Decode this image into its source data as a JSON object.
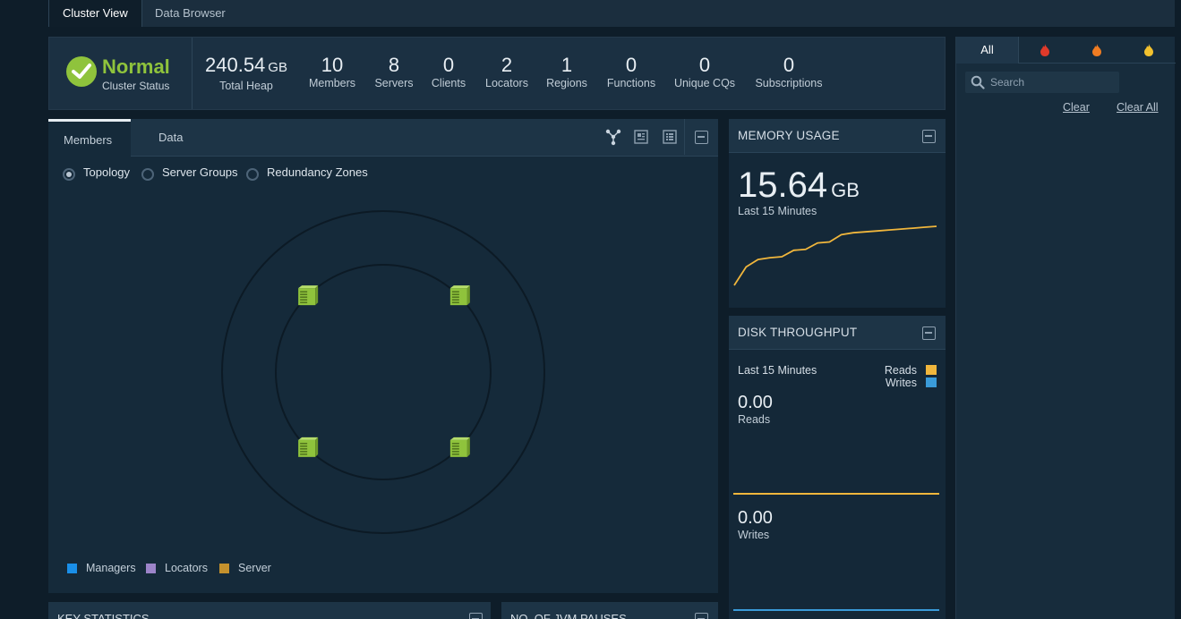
{
  "tabs": {
    "cluster_view": "Cluster View",
    "data_browser": "Data Browser"
  },
  "status": {
    "state": "Normal",
    "label": "Cluster Status",
    "color": "#8fc33c"
  },
  "stats": {
    "heap": {
      "value": "240.54",
      "unit": "GB",
      "label": "Total Heap"
    },
    "members": {
      "value": "10",
      "label": "Members"
    },
    "servers": {
      "value": "8",
      "label": "Servers"
    },
    "clients": {
      "value": "0",
      "label": "Clients"
    },
    "locators": {
      "value": "2",
      "label": "Locators"
    },
    "regions": {
      "value": "1",
      "label": "Regions"
    },
    "functions": {
      "value": "0",
      "label": "Functions"
    },
    "unique_cqs": {
      "value": "0",
      "label": "Unique CQs"
    },
    "subscriptions": {
      "value": "0",
      "label": "Subscriptions"
    }
  },
  "members_panel": {
    "tabs": {
      "members": "Members",
      "data": "Data"
    },
    "toolbar_icons": [
      "topology-view-icon",
      "detail-view-icon",
      "grid-view-icon",
      "minimize-icon"
    ],
    "view_options": {
      "topology": "Topology",
      "server_groups": "Server Groups",
      "redundancy_zones": "Redundancy Zones",
      "selected": "Topology"
    },
    "legend": {
      "managers": {
        "label": "Managers",
        "color": "#1a8fe8"
      },
      "locators": {
        "label": "Locators",
        "color": "#9c84c9"
      },
      "server": {
        "label": "Server",
        "color": "#c4912d"
      }
    },
    "member_icon_color": "#8fc33c",
    "member_node_count": 4
  },
  "memory_usage": {
    "title": "MEMORY USAGE",
    "value": "15.64",
    "unit": "GB",
    "period": "Last 15 Minutes",
    "line_color": "#f0b63c",
    "chart_data": {
      "type": "line",
      "series": [
        {
          "values": [
            0,
            20,
            28,
            30,
            31,
            38,
            39,
            46,
            47,
            55,
            57,
            58,
            59,
            60,
            61,
            62,
            63,
            64
          ]
        }
      ]
    }
  },
  "disk_throughput": {
    "title": "DISK THROUGHPUT",
    "period": "Last 15 Minutes",
    "legend": {
      "reads": {
        "label": "Reads",
        "color": "#f0b63c"
      },
      "writes": {
        "label": "Writes",
        "color": "#3a9bd9"
      }
    },
    "reads": {
      "value": "0.00",
      "label": "Reads"
    },
    "writes": {
      "value": "0.00",
      "label": "Writes"
    }
  },
  "alerts_panel": {
    "tabs": {
      "all": "All",
      "severe_icon": "flame-red-icon",
      "error_icon": "flame-orange-icon",
      "warning_icon": "flame-yellow-icon"
    },
    "search_placeholder": "Search",
    "clear": "Clear",
    "clear_all": "Clear All"
  },
  "bottom_panels": {
    "key_statistics": "KEY STATISTICS",
    "jvm_pauses": "NO. OF JVM PAUSES"
  }
}
